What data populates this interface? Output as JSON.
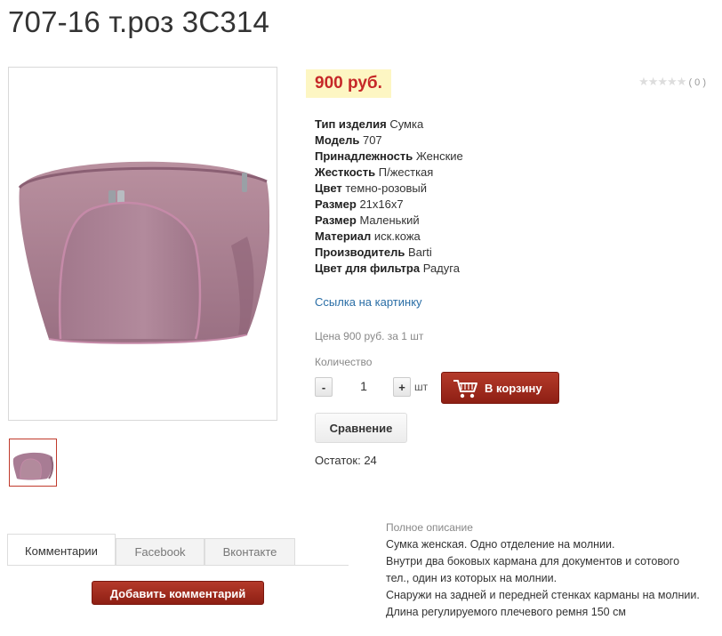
{
  "product": {
    "title": "707-16 т.роз 3С314",
    "price": "900 руб.",
    "rating_count": "( 0 )",
    "stars": "★★★★★"
  },
  "specs": [
    {
      "label": "Тип изделия",
      "value": "Сумка"
    },
    {
      "label": "Модель",
      "value": "707"
    },
    {
      "label": "Принадлежность",
      "value": "Женские"
    },
    {
      "label": "Жесткость",
      "value": "П/жесткая"
    },
    {
      "label": "Цвет",
      "value": "темно-розовый"
    },
    {
      "label": "Размер",
      "value": "21x16x7"
    },
    {
      "label": "Размер",
      "value": "Маленький"
    },
    {
      "label": "Материал",
      "value": "иск.кожа"
    },
    {
      "label": "Производитель",
      "value": "Barti"
    },
    {
      "label": "Цвет для фильтра",
      "value": "Радуга"
    }
  ],
  "image_link": "Ссылка на картинку",
  "price_per_unit": "Цена 900 руб. за 1 шт",
  "quantity": {
    "label": "Количество",
    "minus": "-",
    "value": "1",
    "plus": "+",
    "unit": "шт"
  },
  "cart_button": "В корзину",
  "compare_button": "Сравнение",
  "stock": "Остаток: 24",
  "tabs": [
    {
      "label": "Комментарии",
      "active": true
    },
    {
      "label": "Facebook",
      "active": false
    },
    {
      "label": "Вконтакте",
      "active": false
    }
  ],
  "add_comment_button": "Добавить комментарий",
  "description": {
    "title": "Полное описание",
    "lines": [
      "Сумка женская. Одно отделение на молнии.",
      "Внутри два боковых кармана для документов и сотового",
      "тел., один из которых на молнии.",
      "Снаружи на задней и передней стенках карманы на молнии.",
      "Длина регулируемого плечевого ремня 150 см"
    ]
  },
  "colors": {
    "price_bg": "#fdf6c3",
    "price_text": "#c62828",
    "accent_button": "#9e2a1c",
    "link": "#2a6ea6",
    "bag": "#a87c94"
  }
}
